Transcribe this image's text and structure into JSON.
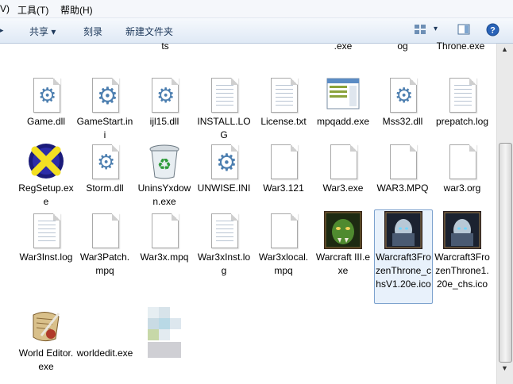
{
  "menu": {
    "partial": "V)",
    "tools": "工具(T)",
    "help": "帮助(H)"
  },
  "toolbar": {
    "share": "共享",
    "burn": "刻录",
    "new_folder": "新建文件夹",
    "dropdown_arrow": "▾"
  },
  "cutoff": {
    "c1": "ts",
    "c2": ".exe",
    "c3": "og",
    "c4": "Throne.exe"
  },
  "files": [
    {
      "label": "Game.dll"
    },
    {
      "label": "GameStart.ini"
    },
    {
      "label": "ijl15.dll"
    },
    {
      "label": "INSTALL.LOG"
    },
    {
      "label": "License.txt"
    },
    {
      "label": "mpqadd.exe"
    },
    {
      "label": "Mss32.dll"
    },
    {
      "label": "prepatch.log"
    },
    {
      "label": "RegSetup.exe"
    },
    {
      "label": "Storm.dll"
    },
    {
      "label": "UninsYxdown.exe"
    },
    {
      "label": "UNWISE.INI"
    },
    {
      "label": "War3.121"
    },
    {
      "label": "War3.exe"
    },
    {
      "label": "WAR3.MPQ"
    },
    {
      "label": "war3.org"
    },
    {
      "label": "War3Inst.log"
    },
    {
      "label": "War3Patch.mpq"
    },
    {
      "label": "War3x.mpq"
    },
    {
      "label": "War3xInst.log"
    },
    {
      "label": "War3xlocal.mpq"
    },
    {
      "label": "Warcraft III.exe"
    },
    {
      "label": "Warcraft3FrozenThrone_chsV1.20e.ico"
    },
    {
      "label": "Warcraft3FrozenThrone1.20e_chs.ico"
    },
    {
      "label": "World Editor.exe"
    },
    {
      "label": "worldedit.exe"
    }
  ]
}
